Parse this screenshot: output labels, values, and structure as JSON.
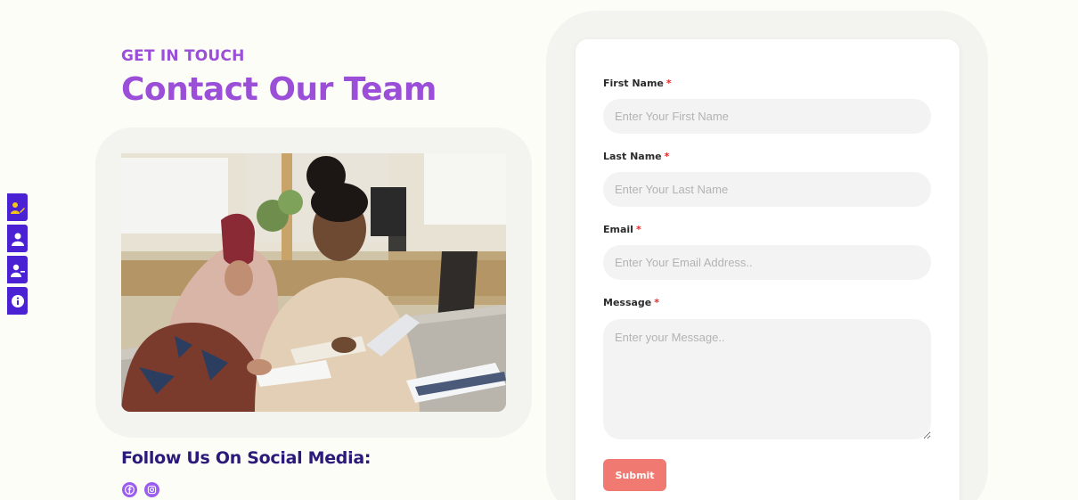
{
  "side_toolbar": {
    "items": [
      {
        "icon": "user-edit-icon"
      },
      {
        "icon": "user-icon"
      },
      {
        "icon": "user-minus-icon"
      },
      {
        "icon": "info-icon"
      }
    ],
    "accent": "#4a22d4",
    "highlight": "#f5c518"
  },
  "hero": {
    "eyebrow": "GET IN TOUCH",
    "title": "Contact Our Team",
    "color": "#9b4fd8"
  },
  "social": {
    "heading": "Follow Us On Social Media:",
    "icons": [
      "facebook-icon",
      "instagram-icon"
    ],
    "color": "#9b5cf0"
  },
  "form": {
    "first_name": {
      "label": "First Name",
      "required": "*",
      "placeholder": "Enter Your First Name",
      "value": ""
    },
    "last_name": {
      "label": "Last Name",
      "required": "*",
      "placeholder": "Enter Your Last Name",
      "value": ""
    },
    "email": {
      "label": "Email",
      "required": "*",
      "placeholder": "Enter Your Email Address..",
      "value": ""
    },
    "message": {
      "label": "Message",
      "required": "*",
      "placeholder": "Enter your Message..",
      "value": ""
    },
    "submit_label": "Submit",
    "submit_color": "#f07a72"
  }
}
